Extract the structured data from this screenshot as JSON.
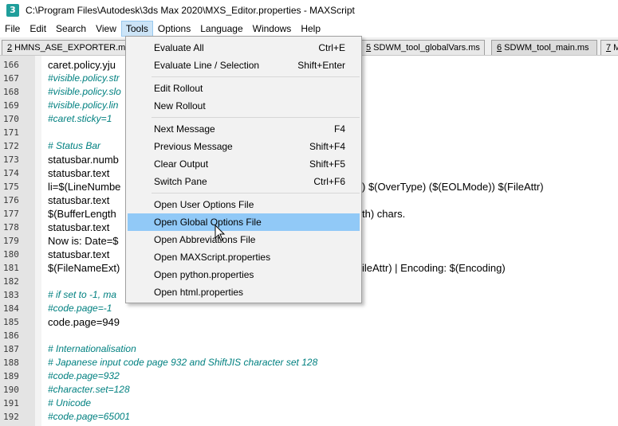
{
  "window": {
    "title": "C:\\Program Files\\Autodesk\\3ds Max 2020\\MXS_Editor.properties - MAXScript",
    "icon": "3"
  },
  "menubar": {
    "items": [
      "File",
      "Edit",
      "Search",
      "View",
      "Tools",
      "Options",
      "Language",
      "Windows",
      "Help"
    ],
    "active": "Tools"
  },
  "tabs": [
    {
      "num": "2",
      "label": " HMNS_ASE_EXPORTER.ms"
    },
    {
      "num": "5",
      "label": " SDWM_tool_globalVars.ms"
    },
    {
      "num": "6",
      "label": " SDWM_tool_main.ms"
    },
    {
      "num": "7",
      "label": " M"
    }
  ],
  "tools_menu": {
    "groups": [
      [
        {
          "label": "Evaluate All",
          "shortcut": "Ctrl+E"
        },
        {
          "label": "Evaluate Line / Selection",
          "shortcut": "Shift+Enter"
        }
      ],
      [
        {
          "label": "Edit Rollout",
          "shortcut": ""
        },
        {
          "label": "New Rollout",
          "shortcut": ""
        }
      ],
      [
        {
          "label": "Next Message",
          "shortcut": "F4"
        },
        {
          "label": "Previous Message",
          "shortcut": "Shift+F4"
        },
        {
          "label": "Clear Output",
          "shortcut": "Shift+F5"
        },
        {
          "label": "Switch Pane",
          "shortcut": "Ctrl+F6"
        }
      ],
      [
        {
          "label": "Open User Options File",
          "shortcut": ""
        },
        {
          "label": "Open Global Options File",
          "shortcut": ""
        },
        {
          "label": "Open Abbreviations File",
          "shortcut": ""
        },
        {
          "label": "Open MAXScript.properties",
          "shortcut": ""
        },
        {
          "label": "Open python.properties",
          "shortcut": ""
        },
        {
          "label": "Open html.properties",
          "shortcut": ""
        }
      ]
    ],
    "highlighted": "Open Global Options File"
  },
  "editor": {
    "lines": [
      {
        "n": "166",
        "text": "caret.policy.yju",
        "comment": false
      },
      {
        "n": "167",
        "text": "#visible.policy.str",
        "comment": true
      },
      {
        "n": "168",
        "text": "#visible.policy.slo",
        "comment": true
      },
      {
        "n": "169",
        "text": "#visible.policy.lin",
        "comment": true
      },
      {
        "n": "170",
        "text": "#caret.sticky=1",
        "comment": true
      },
      {
        "n": "171",
        "text": "",
        "comment": false
      },
      {
        "n": "172",
        "text": "# Status Bar",
        "comment": true
      },
      {
        "n": "173",
        "text": "statusbar.numb",
        "comment": false
      },
      {
        "n": "174",
        "text": "statusbar.text",
        "comment": false
      },
      {
        "n": "175",
        "text": "li=$(LineNumbe",
        "comment": false,
        "tail": ") $(OverType) ($(EOLMode)) $(FileAttr)"
      },
      {
        "n": "176",
        "text": "statusbar.text",
        "comment": false
      },
      {
        "n": "177",
        "text": "$(BufferLength",
        "comment": false,
        "tail": "th) chars."
      },
      {
        "n": "178",
        "text": "statusbar.text",
        "comment": false
      },
      {
        "n": "179",
        "text": "Now is: Date=$",
        "comment": false
      },
      {
        "n": "180",
        "text": "statusbar.text",
        "comment": false
      },
      {
        "n": "181",
        "text": "$(FileNameExt)",
        "comment": false,
        "tail": "ileAttr) | Encoding: $(Encoding)"
      },
      {
        "n": "182",
        "text": "",
        "comment": false
      },
      {
        "n": "183",
        "text": "# if set to -1, ma",
        "comment": true
      },
      {
        "n": "184",
        "text": "#code.page=-1",
        "comment": true
      },
      {
        "n": "185",
        "text": "code.page=949",
        "comment": false
      },
      {
        "n": "186",
        "text": "",
        "comment": false
      },
      {
        "n": "187",
        "text": "# Internationalisation",
        "comment": true
      },
      {
        "n": "188",
        "text": "# Japanese input code page 932 and ShiftJIS character set 128",
        "comment": true
      },
      {
        "n": "189",
        "text": "#code.page=932",
        "comment": true
      },
      {
        "n": "190",
        "text": "#character.set=128",
        "comment": true
      },
      {
        "n": "191",
        "text": "# Unicode",
        "comment": true
      },
      {
        "n": "192",
        "text": "#code.page=65001",
        "comment": true
      }
    ]
  },
  "colors": {
    "comment": "#008080",
    "menu_highlight": "#91c9f7",
    "gutter": "#e4e4e4"
  },
  "icons": {
    "cursor": "mouse-pointer-icon",
    "app": "maxscript-app-icon"
  }
}
